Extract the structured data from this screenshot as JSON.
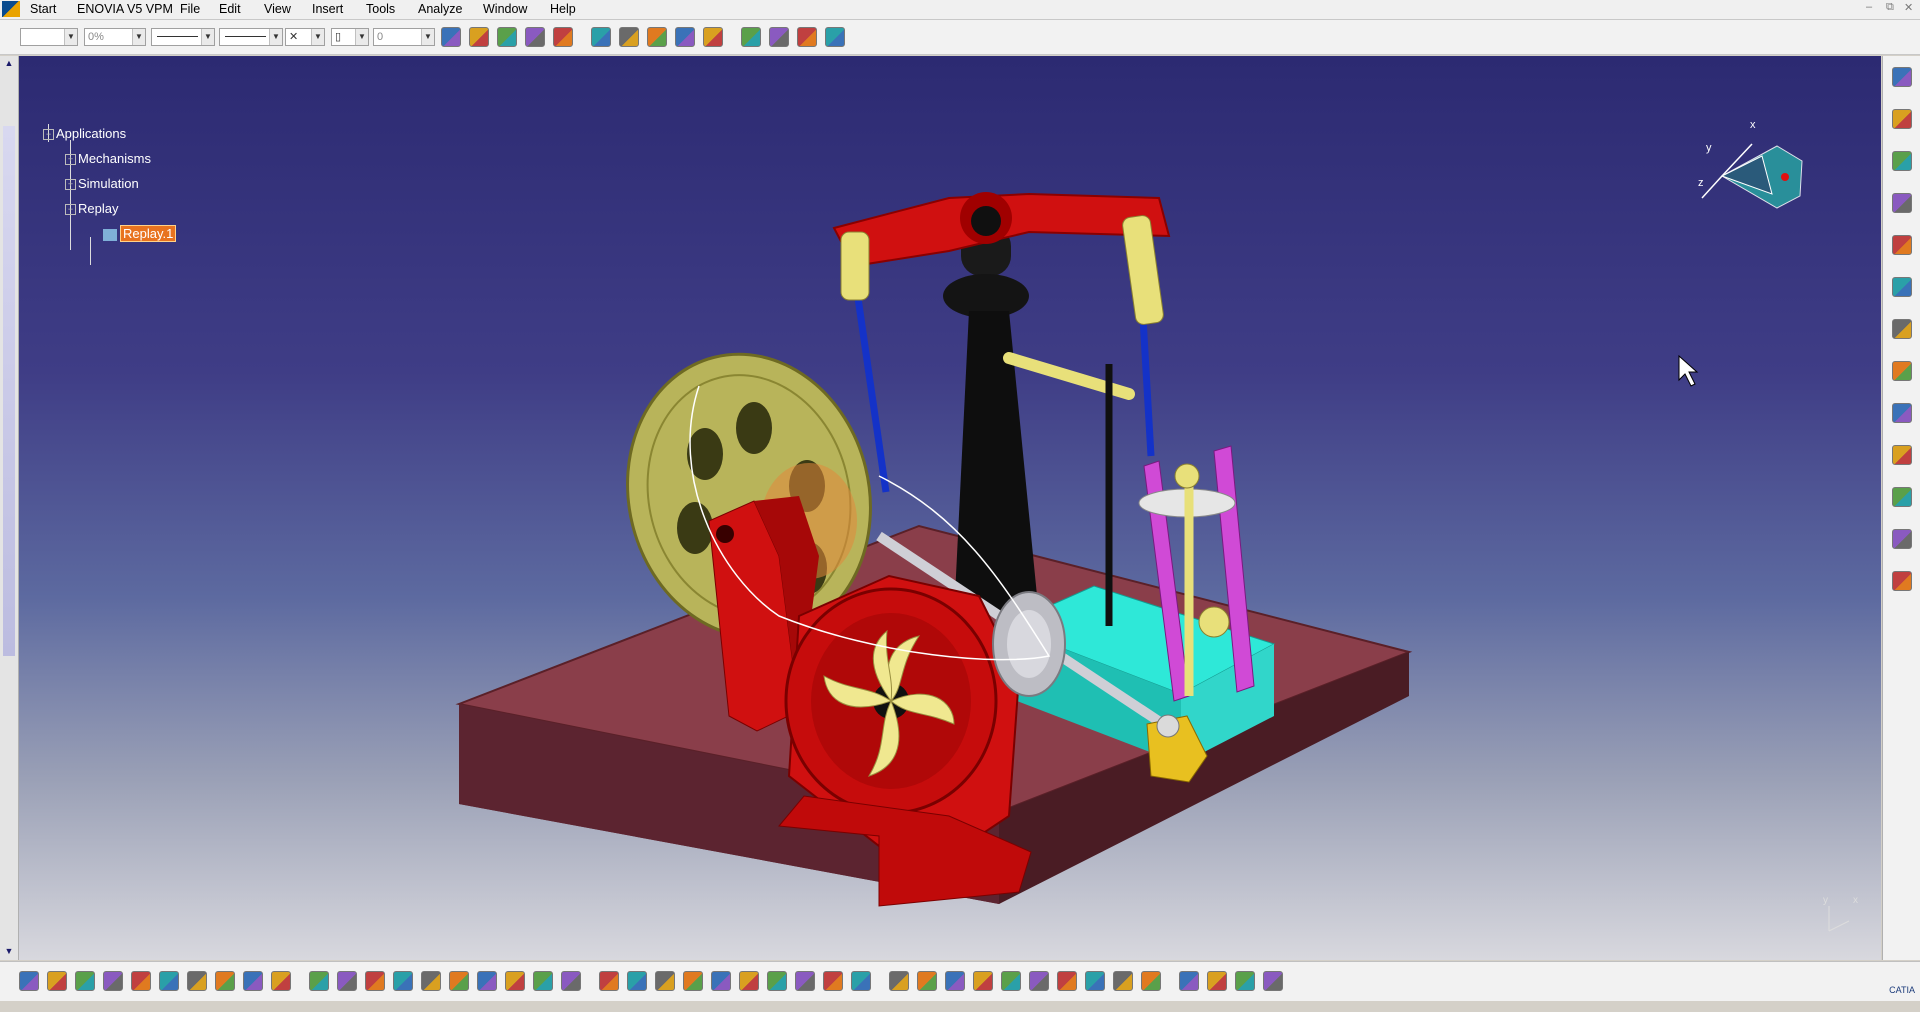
{
  "menubar": {
    "items": [
      "Start",
      "ENOVIA V5 VPM",
      "File",
      "Edit",
      "View",
      "Insert",
      "Tools",
      "Analyze",
      "Window",
      "Help"
    ]
  },
  "toolbar_top": {
    "percent_value": "0%",
    "layer_value": "0"
  },
  "spec_tree": {
    "root": "Applications",
    "children": [
      "Mechanisms",
      "Simulation",
      "Replay"
    ],
    "replay_child": "Replay.1"
  },
  "compass": {
    "x_label": "x",
    "y_label": "y",
    "z_label": "z"
  },
  "axis_triad": {
    "x_label": "x",
    "y_label": "y"
  },
  "brand": {
    "logo_text": "CATIA"
  },
  "colors": {
    "viewport_top": "#2c2a72",
    "highlight": "#e8731f",
    "frame_red": "#d01010",
    "base_brown": "#6a2c34",
    "pulley_olive": "#b8b45a",
    "cylinder_cyan": "#2ee8d8",
    "rod_magenta": "#d04ad6",
    "rod_blue": "#1432c8"
  },
  "toolbar_top_icons": [
    "draft-icon",
    "paint-icon",
    "select-icon",
    "snap-icon",
    "snap2-icon",
    "constraint-icon",
    "manipulate-icon",
    "assembly-icon",
    "catalog-icon",
    "part-icon",
    "mechanism-icon",
    "tools-icon",
    "kinematics-icon",
    "replay-icon"
  ],
  "toolbar_bottom_icons": [
    "new-icon",
    "open-icon",
    "save-icon",
    "print-icon",
    "cut-icon",
    "copy-icon",
    "paste-icon",
    "undo-icon",
    "redo-icon",
    "whats-this-icon",
    "formula-icon",
    "comment-icon",
    "light-icon",
    "table-icon",
    "graph-icon",
    "analyze-icon",
    "measure-icon",
    "fly-icon",
    "fit-all-icon",
    "pan-icon",
    "rotate-icon",
    "zoom-in-icon",
    "zoom-out-icon",
    "normal-view-icon",
    "multi-view-icon",
    "iso-view-icon",
    "shading-icon",
    "hide-show-icon",
    "swap-icon",
    "grid-icon",
    "step-icon",
    "forward-icon",
    "back-icon",
    "link-icon",
    "camera-icon",
    "compass-icon",
    "first-icon",
    "last-icon",
    "zoom-box-icon",
    "section-icon",
    "fill-icon",
    "light-source-icon",
    "swap-visible-icon",
    "tree-icon"
  ],
  "toolbar_right_icons": [
    "fly-mode-icon",
    "select-arrow-icon",
    "kinematics-joint-icon",
    "revolute-joint-icon",
    "prismatic-joint-icon",
    "gear-joint-icon",
    "rack-joint-icon",
    "cable-joint-icon",
    "cam-joint-icon",
    "simulation-icon",
    "swept-volume-icon",
    "trace-icon",
    "analysis-icon"
  ]
}
